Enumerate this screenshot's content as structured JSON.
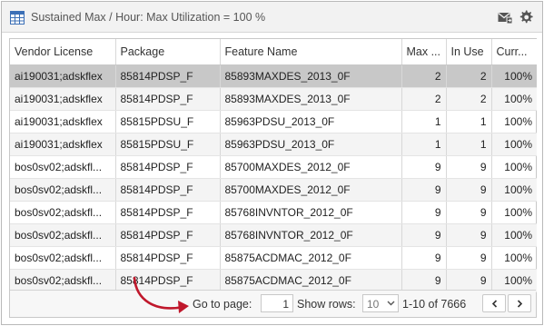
{
  "header": {
    "title": "Sustained Max / Hour: Max Utilization = 100 %",
    "icons": [
      "table-icon",
      "mail-icon",
      "gear-icon"
    ]
  },
  "table": {
    "columns": [
      "Vendor License",
      "Package",
      "Feature Name",
      "Max ...",
      "In Use",
      "Curr..."
    ],
    "rows": [
      {
        "vendor": "ai190031;adskflex",
        "package": "85814PDSP_F",
        "feature": "85893MAXDES_2013_0F",
        "max": "2",
        "in_use": "2",
        "curr": "100%"
      },
      {
        "vendor": "ai190031;adskflex",
        "package": "85814PDSP_F",
        "feature": "85893MAXDES_2013_0F",
        "max": "2",
        "in_use": "2",
        "curr": "100%"
      },
      {
        "vendor": "ai190031;adskflex",
        "package": "85815PDSU_F",
        "feature": "85963PDSU_2013_0F",
        "max": "1",
        "in_use": "1",
        "curr": "100%"
      },
      {
        "vendor": "ai190031;adskflex",
        "package": "85815PDSU_F",
        "feature": "85963PDSU_2013_0F",
        "max": "1",
        "in_use": "1",
        "curr": "100%"
      },
      {
        "vendor": "bos0sv02;adskfl...",
        "package": "85814PDSP_F",
        "feature": "85700MAXDES_2012_0F",
        "max": "9",
        "in_use": "9",
        "curr": "100%"
      },
      {
        "vendor": "bos0sv02;adskfl...",
        "package": "85814PDSP_F",
        "feature": "85700MAXDES_2012_0F",
        "max": "9",
        "in_use": "9",
        "curr": "100%"
      },
      {
        "vendor": "bos0sv02;adskfl...",
        "package": "85814PDSP_F",
        "feature": "85768INVNTOR_2012_0F",
        "max": "9",
        "in_use": "9",
        "curr": "100%"
      },
      {
        "vendor": "bos0sv02;adskfl...",
        "package": "85814PDSP_F",
        "feature": "85768INVNTOR_2012_0F",
        "max": "9",
        "in_use": "9",
        "curr": "100%"
      },
      {
        "vendor": "bos0sv02;adskfl...",
        "package": "85814PDSP_F",
        "feature": "85875ACDMAC_2012_0F",
        "max": "9",
        "in_use": "9",
        "curr": "100%"
      },
      {
        "vendor": "bos0sv02;adskfl...",
        "package": "85814PDSP_F",
        "feature": "85875ACDMAC_2012_0F",
        "max": "9",
        "in_use": "9",
        "curr": "100%"
      }
    ]
  },
  "pager": {
    "go_to_label": "Go to page:",
    "page_value": "1",
    "show_rows_label": "Show rows:",
    "rows_value": "10",
    "range": "1-10 of 7666",
    "prev_icon": "chevron-left-icon",
    "next_icon": "chevron-right-icon"
  },
  "colors": {
    "selected_row": "#c8c8c8",
    "alt_row": "#f4f4f4",
    "annotation_arrow": "#c0182c"
  }
}
